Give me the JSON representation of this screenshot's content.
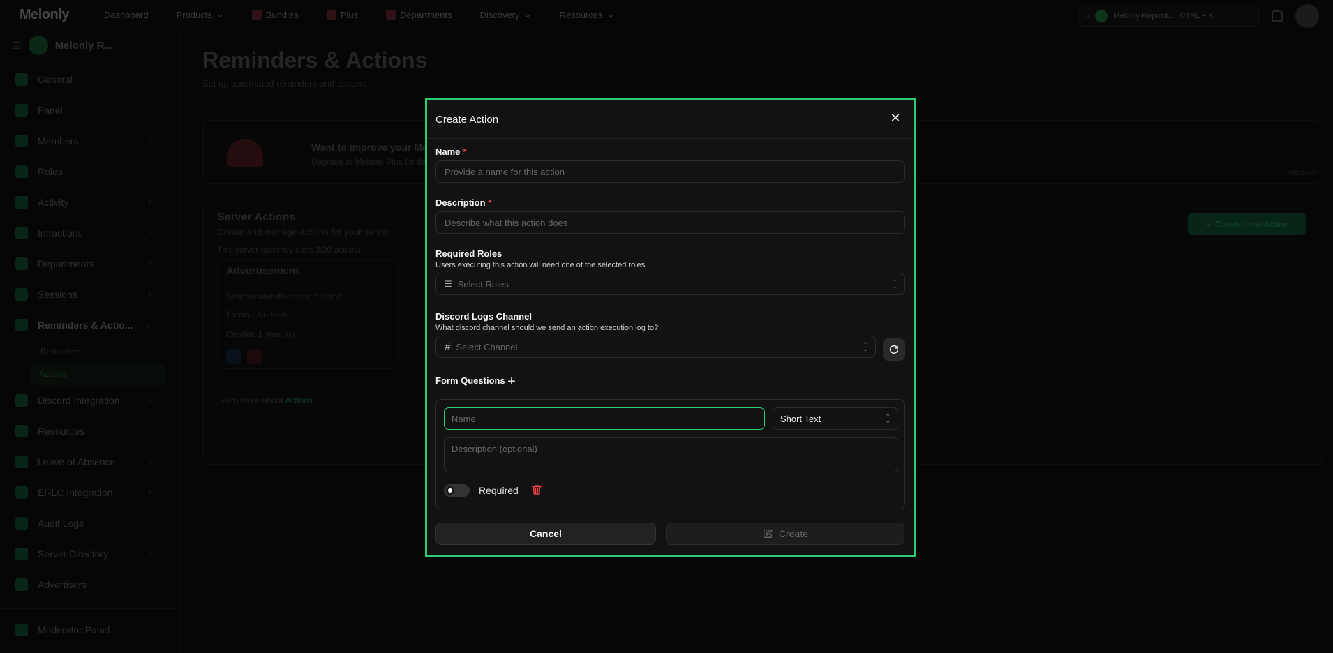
{
  "nav": {
    "logo": "Melonly",
    "links": [
      "Dashboard",
      "Products",
      "Bundles",
      "Plus",
      "Departments",
      "Discovery",
      "Resources"
    ],
    "search_label": "Melonly Reposit...",
    "search_shortcut": "CTRL + K"
  },
  "sidebar": {
    "server_name": "Melonly R...",
    "items": [
      {
        "label": "General"
      },
      {
        "label": "Panel"
      },
      {
        "label": "Members"
      },
      {
        "label": "Roles"
      },
      {
        "label": "Activity"
      },
      {
        "label": "Infractions"
      },
      {
        "label": "Departments"
      },
      {
        "label": "Sessions"
      },
      {
        "label": "Reminders & Actio..."
      },
      {
        "label": "Discord Integration"
      },
      {
        "label": "Resources"
      },
      {
        "label": "Leave of Absence"
      },
      {
        "label": "ERLC Integration"
      },
      {
        "label": "Audit Logs"
      },
      {
        "label": "Server Directory"
      },
      {
        "label": "Advertisers"
      }
    ],
    "sub_items": [
      "Reminders",
      "Actions"
    ],
    "footer": "Moderator Panel"
  },
  "page": {
    "title": "Reminders & Actions",
    "subtitle": "Set up automated reminders and actions",
    "promo_title": "Want to improve your Me",
    "promo_sub": "Upgrade to Melonly Plus for the",
    "promo_tag": "MELONLY",
    "section_title": "Server Actions",
    "section_sub": "Create and manage actions for your server",
    "usage": "This server currently uses 3/20 actions",
    "create_new": "Create new Action",
    "action_card": {
      "title": "Advertisement",
      "desc": "Sent an advertisement in game",
      "forms": "Forms · No form",
      "created": "Created 1 year ago"
    },
    "learn_more": "Learn more about",
    "learn_link": "Actions"
  },
  "modal": {
    "title": "Create Action",
    "name_label": "Name",
    "name_placeholder": "Provide a name for this action",
    "description_label": "Description",
    "description_placeholder": "Describe what this action does",
    "roles_label": "Required Roles",
    "roles_hint": "Users executing this action will need one of the selected roles",
    "roles_placeholder": "Select Roles",
    "channel_label": "Discord Logs Channel",
    "channel_hint": "What discord channel should we send an action execution log to?",
    "channel_placeholder": "Select Channel",
    "form_questions_label": "Form Questions",
    "question": {
      "name_placeholder": "Name",
      "type_value": "Short Text",
      "desc_placeholder": "Description (optional)",
      "required_label": "Required",
      "required_on": false
    },
    "cancel_label": "Cancel",
    "create_label": "Create",
    "accent_color": "#2ecc71",
    "required_color": "#ef4444"
  }
}
